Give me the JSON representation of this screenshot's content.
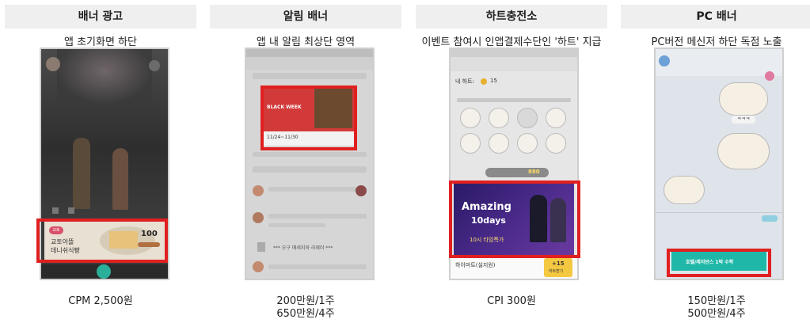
{
  "columns": [
    {
      "title": "배너 광고",
      "description": "앱 초기화면 하단",
      "price_lines": [
        "CPM 2,500원"
      ],
      "mock": {
        "banner_text_1": "교토아뜰",
        "banner_text_2": "데니쉬식빵",
        "banner_badge": "100",
        "logo_text": "교토"
      }
    },
    {
      "title": "알림 배너",
      "description": "앱 내 알림 최상단 영역",
      "price_lines": [
        "200만원/1주",
        "650만원/4주"
      ],
      "mock": {
        "banner_title": "BLACK WEEK",
        "banner_date": "11/24~11/30",
        "list_footer": "*** 오구 메세지와 라제러 ***"
      }
    },
    {
      "title": "하트충전소",
      "description": "이벤트 참여시 인앱결제수단인 '하트' 지급",
      "price_lines": [
        "CPI 300원"
      ],
      "mock": {
        "heart_label": "내 하트:",
        "heart_count": "15",
        "coin_value": "880",
        "ad_title_1": "Amazing",
        "ad_title_2": "10days",
        "ad_sub": "10시 타임특가",
        "store_name": "하이마트(실지원)",
        "reward": "+15",
        "reward_label": "하트받기"
      }
    },
    {
      "title": "PC 배너",
      "description": "PC버전 메신저 하단 독점 노출",
      "price_lines": [
        "150만원/1주",
        "500만원/4주"
      ],
      "mock": {
        "bubble_text": "ㅋㅋㅋ",
        "banner_text": "호텔/레지던스 1박 수학"
      }
    }
  ],
  "colors": {
    "highlight": "#e02020",
    "header_bg": "#efefef",
    "ad_purple": "#4a2a8a",
    "ad_yellow": "#f5c842",
    "pc_banner": "#1fb8a8"
  }
}
